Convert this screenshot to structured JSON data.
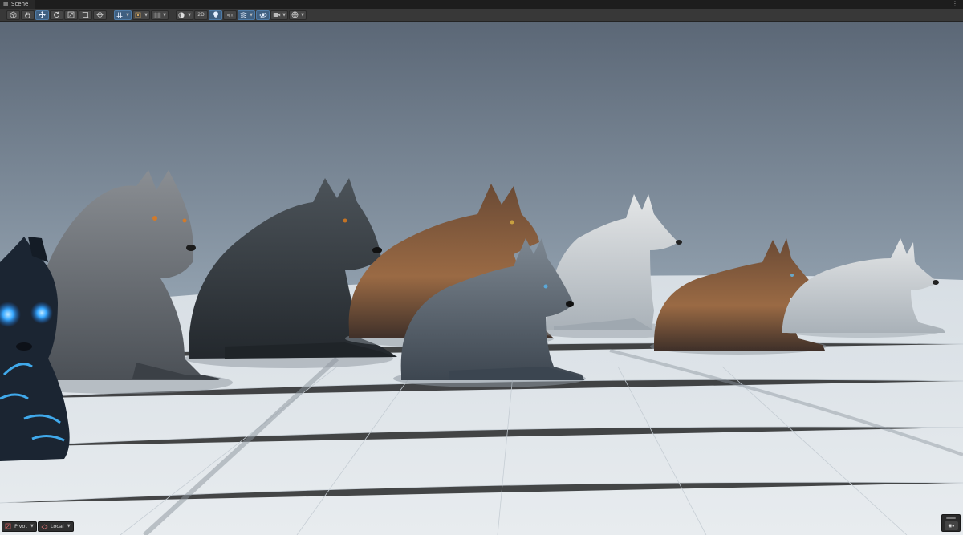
{
  "tab": {
    "label": "Scene",
    "icon": "scene-grid-icon"
  },
  "tab_menu_icon": "kebab-menu-icon",
  "toolbar": {
    "tools": [
      {
        "icon": "view-cube-icon",
        "active": false
      },
      {
        "icon": "hand-icon",
        "active": false
      },
      {
        "icon": "move-icon",
        "active": true
      },
      {
        "icon": "rotate-icon",
        "active": false
      },
      {
        "icon": "scale-icon",
        "active": false
      },
      {
        "icon": "rect-tool-icon",
        "active": false
      },
      {
        "icon": "transform-icon",
        "active": false
      }
    ],
    "two_d_label": "2D",
    "accent_color": "#4d7aa6"
  },
  "bottom_tools": {
    "pivot_label": "Pivot",
    "local_label": "Local"
  },
  "viewport": {
    "sky_top": "#5e6a78",
    "sky_bottom": "#b7c3cd",
    "floor_color": "#dfe5ea"
  }
}
